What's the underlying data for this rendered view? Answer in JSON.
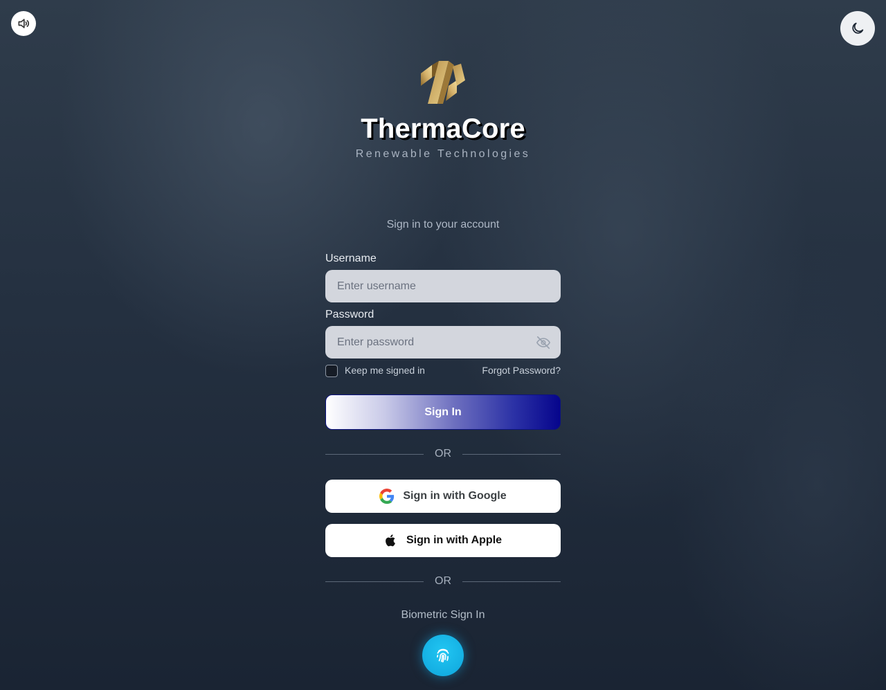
{
  "controls": {
    "sound_icon": "volume-icon",
    "theme_icon": "moon-icon"
  },
  "brand": {
    "logo_icon": "thermacore-logo",
    "title": "ThermaCore",
    "subtitle": "Renewable Technologies"
  },
  "form": {
    "heading": "Sign in to your account",
    "username_label": "Username",
    "username_placeholder": "Enter username",
    "password_label": "Password",
    "password_placeholder": "Enter password",
    "password_toggle_icon": "eye-off-icon",
    "keep_signed_in_label": "Keep me signed in",
    "keep_signed_in_checked": false,
    "forgot_password": "Forgot Password?",
    "sign_in_label": "Sign In"
  },
  "dividers": {
    "first": "OR",
    "second": "OR"
  },
  "social": {
    "google_label": "Sign in with Google",
    "google_icon": "google-icon",
    "apple_label": "Sign in with Apple",
    "apple_icon": "apple-icon"
  },
  "biometric": {
    "label": "Biometric Sign In",
    "icon": "fingerprint-icon"
  },
  "colors": {
    "accent_gold": "#c9a25a",
    "biometric_blue": "#14b4e6",
    "sign_in_gradient_end": "#06058c"
  }
}
